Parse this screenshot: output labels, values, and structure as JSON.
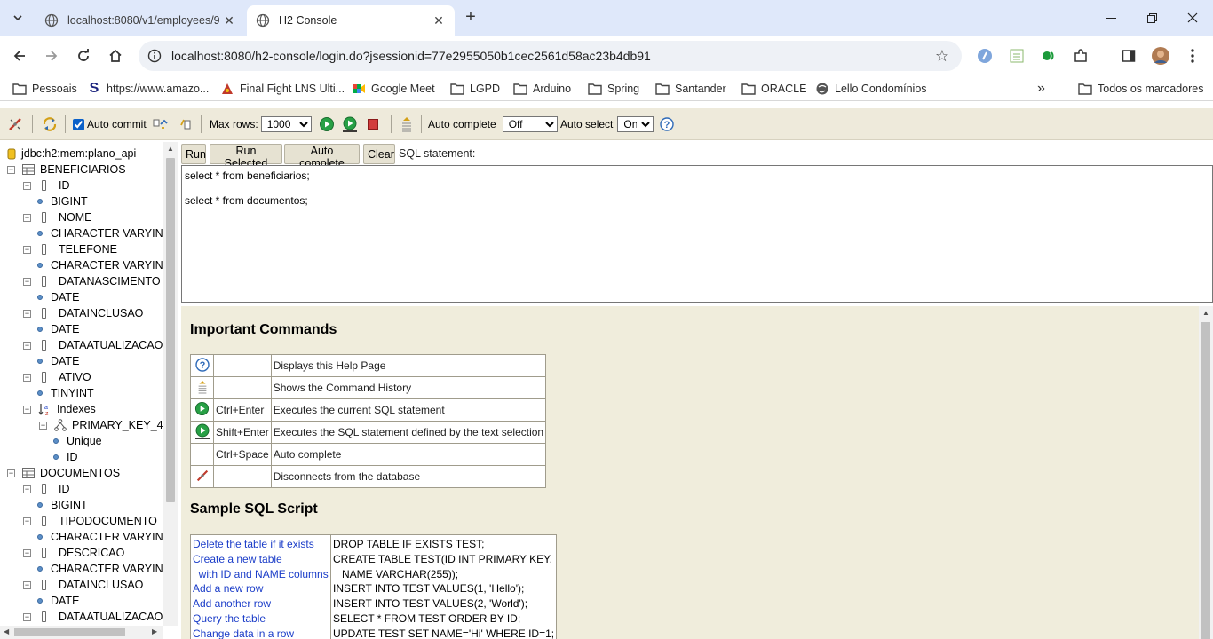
{
  "browser": {
    "tabs": [
      {
        "title": "localhost:8080/v1/employees/9"
      },
      {
        "title": "H2 Console"
      }
    ],
    "url": "localhost:8080/h2-console/login.do?jsessionid=77e2955050b1cec2561d58ac23b4db91",
    "bookmarks": [
      "Pessoais",
      "https://www.amazo...",
      "Final Fight LNS Ulti...",
      "Google Meet",
      "LGPD",
      "Arduino",
      "Spring",
      "Santander",
      "ORACLE",
      "Lello Condomínios"
    ],
    "all_bookmarks": "Todos os marcadores",
    "overflow": "»"
  },
  "toolbar": {
    "auto_commit_label": "Auto commit",
    "auto_commit_checked": true,
    "max_rows_label": "Max rows:",
    "max_rows_value": "1000",
    "auto_complete_label": "Auto complete",
    "auto_complete_value": "Off",
    "auto_select_label": "Auto select",
    "auto_select_value": "On"
  },
  "tree": {
    "connection": "jdbc:h2:mem:plano_api",
    "rows": [
      {
        "kind": "table",
        "toggle": "⊟",
        "label": "BENEFICIARIOS",
        "indent": 0
      },
      {
        "kind": "col",
        "toggle": "⊟",
        "label": "ID",
        "indent": 1
      },
      {
        "kind": "type",
        "label": "BIGINT",
        "indent": 2
      },
      {
        "kind": "col",
        "toggle": "⊟",
        "label": "NOME",
        "indent": 1
      },
      {
        "kind": "type",
        "label": "CHARACTER VARYIN",
        "indent": 2
      },
      {
        "kind": "col",
        "toggle": "⊟",
        "label": "TELEFONE",
        "indent": 1
      },
      {
        "kind": "type",
        "label": "CHARACTER VARYIN",
        "indent": 2
      },
      {
        "kind": "col",
        "toggle": "⊟",
        "label": "DATANASCIMENTO",
        "indent": 1
      },
      {
        "kind": "type",
        "label": "DATE",
        "indent": 2
      },
      {
        "kind": "col",
        "toggle": "⊟",
        "label": "DATAINCLUSAO",
        "indent": 1
      },
      {
        "kind": "type",
        "label": "DATE",
        "indent": 2
      },
      {
        "kind": "col",
        "toggle": "⊟",
        "label": "DATAATUALIZACAO",
        "indent": 1
      },
      {
        "kind": "type",
        "label": "DATE",
        "indent": 2
      },
      {
        "kind": "col",
        "toggle": "⊟",
        "label": "ATIVO",
        "indent": 1
      },
      {
        "kind": "type",
        "label": "TINYINT",
        "indent": 2
      },
      {
        "kind": "indexes",
        "toggle": "⊟",
        "label": "Indexes",
        "indent": 1
      },
      {
        "kind": "index",
        "toggle": "⊟",
        "label": "PRIMARY_KEY_4",
        "indent": 2
      },
      {
        "kind": "type",
        "label": "Unique",
        "indent": 3
      },
      {
        "kind": "type",
        "label": "ID",
        "indent": 3
      },
      {
        "kind": "table",
        "toggle": "⊟",
        "label": "DOCUMENTOS",
        "indent": 0
      },
      {
        "kind": "col",
        "toggle": "⊟",
        "label": "ID",
        "indent": 1
      },
      {
        "kind": "type",
        "label": "BIGINT",
        "indent": 2
      },
      {
        "kind": "col",
        "toggle": "⊟",
        "label": "TIPODOCUMENTO",
        "indent": 1
      },
      {
        "kind": "type",
        "label": "CHARACTER VARYIN",
        "indent": 2
      },
      {
        "kind": "col",
        "toggle": "⊟",
        "label": "DESCRICAO",
        "indent": 1
      },
      {
        "kind": "type",
        "label": "CHARACTER VARYIN",
        "indent": 2
      },
      {
        "kind": "col",
        "toggle": "⊟",
        "label": "DATAINCLUSAO",
        "indent": 1
      },
      {
        "kind": "type",
        "label": "DATE",
        "indent": 2
      },
      {
        "kind": "col",
        "toggle": "⊟",
        "label": "DATAATUALIZACAO",
        "indent": 1
      }
    ]
  },
  "sql": {
    "buttons": [
      "Run",
      "Run Selected",
      "Auto complete",
      "Clear"
    ],
    "label": "SQL statement:",
    "text": "select * from beneficiarios;\n\nselect * from documentos;"
  },
  "help": {
    "important_title": "Important Commands",
    "commands": [
      {
        "icon": "help-icon",
        "key": "",
        "desc": "Displays this Help Page"
      },
      {
        "icon": "history-icon",
        "key": "",
        "desc": "Shows the Command History"
      },
      {
        "icon": "run-icon",
        "key": "Ctrl+Enter",
        "desc": "Executes the current SQL statement"
      },
      {
        "icon": "run-selected-icon",
        "key": "Shift+Enter",
        "desc": "Executes the SQL statement defined by the text selection"
      },
      {
        "icon": "",
        "key": "Ctrl+Space",
        "desc": "Auto complete"
      },
      {
        "icon": "disconnect-icon",
        "key": "",
        "desc": "Disconnects from the database"
      }
    ],
    "sample_title": "Sample SQL Script",
    "script": [
      {
        "left": [
          "Delete the table if it exists"
        ],
        "right": [
          "DROP TABLE IF EXISTS TEST;"
        ]
      },
      {
        "left": [
          "Create a new table",
          "  with ID and NAME columns"
        ],
        "right": [
          "CREATE TABLE TEST(ID INT PRIMARY KEY,",
          "   NAME VARCHAR(255));"
        ]
      },
      {
        "left": [
          "Add a new row"
        ],
        "right": [
          "INSERT INTO TEST VALUES(1, 'Hello');"
        ]
      },
      {
        "left": [
          "Add another row"
        ],
        "right": [
          "INSERT INTO TEST VALUES(2, 'World');"
        ]
      },
      {
        "left": [
          "Query the table"
        ],
        "right": [
          "SELECT * FROM TEST ORDER BY ID;"
        ]
      },
      {
        "left": [
          "Change data in a row"
        ],
        "right": [
          "UPDATE TEST SET NAME='Hi' WHERE ID=1;"
        ]
      }
    ]
  }
}
